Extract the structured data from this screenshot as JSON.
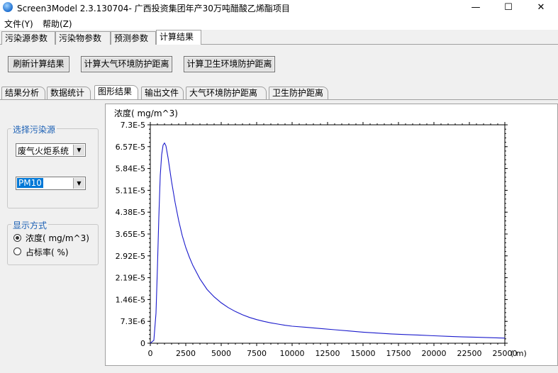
{
  "window": {
    "title": "Screen3Model 2.3.130704- 广西投资集团年产30万吨醋酸乙烯酯项目",
    "minimize": "—",
    "maximize": "☐",
    "close": "✕"
  },
  "menu": [
    "文件(Y)",
    "帮助(Z)"
  ],
  "tabs": [
    "污染源参数",
    "污染物参数",
    "预测参数",
    "计算结果"
  ],
  "active_tab": "计算结果",
  "buttons": {
    "refresh": "刷新计算结果",
    "atmos": "计算大气环境防护距离",
    "health": "计算卫生环境防护距离"
  },
  "subtabs": [
    "结果分析",
    "数据统计",
    "图形结果",
    "输出文件",
    "大气环境防护距离",
    "卫生防护距离"
  ],
  "active_subtab": "图形结果",
  "source_group": {
    "title": "选择污染源",
    "source_value": "废气火炬系统",
    "pollutant_value": "PM10"
  },
  "display_group": {
    "title": "显示方式",
    "options": [
      "浓度( mg/m^3)",
      "占标率( %)"
    ],
    "selected": 0
  },
  "chart_data": {
    "type": "line",
    "ylabel": "浓度( mg/m^3)",
    "xlabel_unit": "( m)",
    "xlim": [
      0,
      25000
    ],
    "ylim": [
      0,
      7.3e-05
    ],
    "x_ticks": [
      "0",
      "2500",
      "5000",
      "7500",
      "10000",
      "12500",
      "15000",
      "17500",
      "20000",
      "22500",
      "25000"
    ],
    "y_ticks": [
      "0",
      "7.3E-6",
      "1.46E-5",
      "2.19E-5",
      "2.92E-5",
      "3.65E-5",
      "4.38E-5",
      "5.11E-5",
      "5.84E-5",
      "6.57E-5",
      "7.3E-5"
    ],
    "line_color": "#1a1acc",
    "series": [
      {
        "x": [
          0,
          250,
          400,
          500,
          600,
          700,
          800,
          900,
          1000,
          1100,
          1250,
          1500,
          1750,
          2000,
          2250,
          2500,
          2750,
          3000,
          3500,
          4000,
          4500,
          5000,
          5500,
          6000,
          6500,
          7000,
          7500,
          8000,
          8500,
          9000,
          9500,
          10000,
          11000,
          12000,
          13000,
          14000,
          15000,
          16000,
          17000,
          18000,
          19000,
          20000,
          21000,
          22000,
          23000,
          24000,
          25000
        ],
        "y": [
          0,
          1e-06,
          1e-05,
          2.5e-05,
          4.2e-05,
          5.6e-05,
          6.3e-05,
          6.62e-05,
          6.69e-05,
          6.6e-05,
          6.2e-05,
          5.4e-05,
          4.7e-05,
          4.1e-05,
          3.6e-05,
          3.2e-05,
          2.88e-05,
          2.6e-05,
          2.15e-05,
          1.8e-05,
          1.55e-05,
          1.35e-05,
          1.19e-05,
          1.06e-05,
          9.5e-06,
          8.6e-06,
          7.9e-06,
          7.3e-06,
          6.8e-06,
          6.4e-06,
          6e-06,
          5.7e-06,
          5.3e-06,
          4.9e-06,
          4.5e-06,
          4.1e-06,
          3.7e-06,
          3.4e-06,
          3.1e-06,
          2.9e-06,
          2.7e-06,
          2.5e-06,
          2.3e-06,
          2.1e-06,
          2e-06,
          1.85e-06,
          1.7e-06
        ]
      }
    ]
  }
}
